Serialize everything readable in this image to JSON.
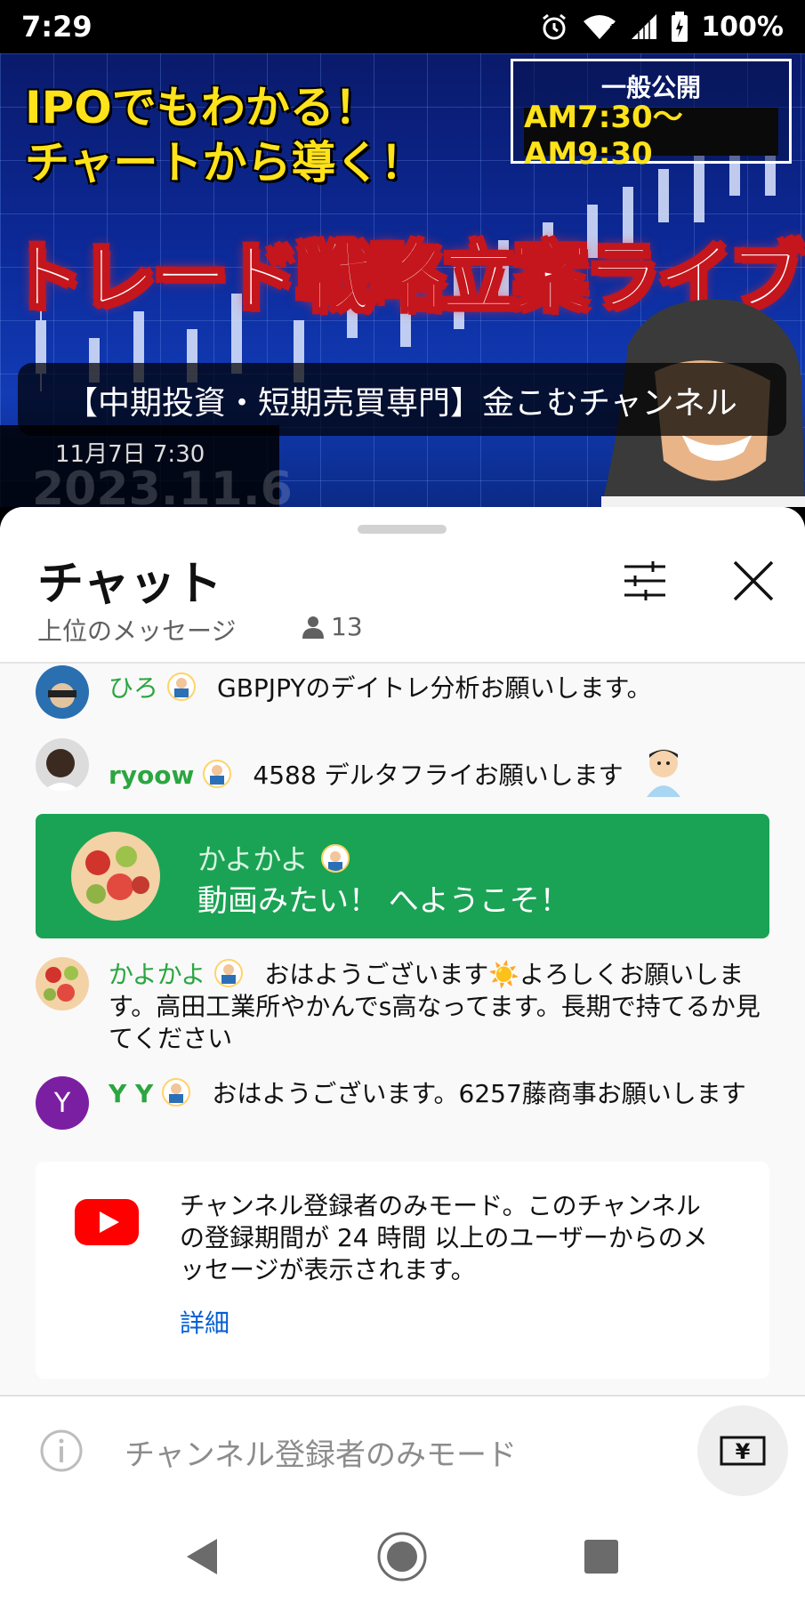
{
  "status_bar": {
    "time": "7:29",
    "battery": "100%"
  },
  "video": {
    "headline_line1": "IPOでもわかる！",
    "headline_line2": "チャートから導く！",
    "public_label": "一般公開",
    "public_time": "AM7:30〜AM9:30",
    "main_title": "トレード戦略立案ライブ",
    "channel_title": "【中期投資・短期売買専門】金こむチャンネル",
    "date": "11月7日 7:30",
    "year_overlay": "2023.11.6"
  },
  "chat": {
    "title": "チャット",
    "subtitle": "上位のメッセージ",
    "viewer_count": "13",
    "messages": [
      {
        "author": "ひろ",
        "text": "GBPJPYのデイトレ分析お願いします。"
      },
      {
        "author": "ryoow",
        "text": "4588 デルタフライお願いします"
      },
      {
        "author": "かよかよ",
        "text": "おはようございます☀️よろしくお願いします。高田工業所やかんでs高なってます。長期で持てるか見てください"
      },
      {
        "author": "Y Y",
        "avatar_letter": "Y",
        "text": "おはようございます。6257藤商事お願いします"
      }
    ],
    "welcome": {
      "author": "かよかよ",
      "text": "動画みたい！ へようこそ！"
    },
    "notice": {
      "text": "チャンネル登録者のみモード。このチャンネルの登録期間が 24 時間 以上のユーザーからのメッセージが表示されます。",
      "link": "詳細"
    },
    "input_placeholder": "チャンネル登録者のみモード",
    "super_chat_symbol": "¥"
  },
  "colors": {
    "accent_green": "#2ba640",
    "welcome_bg": "#1aa354",
    "link_blue": "#065fd4",
    "youtube_red": "#ff0000",
    "heart_red": "#e8101f",
    "yy_avatar": "#7b1fa2"
  },
  "icons": [
    "alarm-icon",
    "wifi-icon",
    "signal-icon",
    "battery-icon",
    "person-icon",
    "filter-icon",
    "close-icon",
    "youtube-icon",
    "heart-icon",
    "info-icon",
    "yen-icon",
    "back-icon",
    "home-icon",
    "recents-icon"
  ]
}
